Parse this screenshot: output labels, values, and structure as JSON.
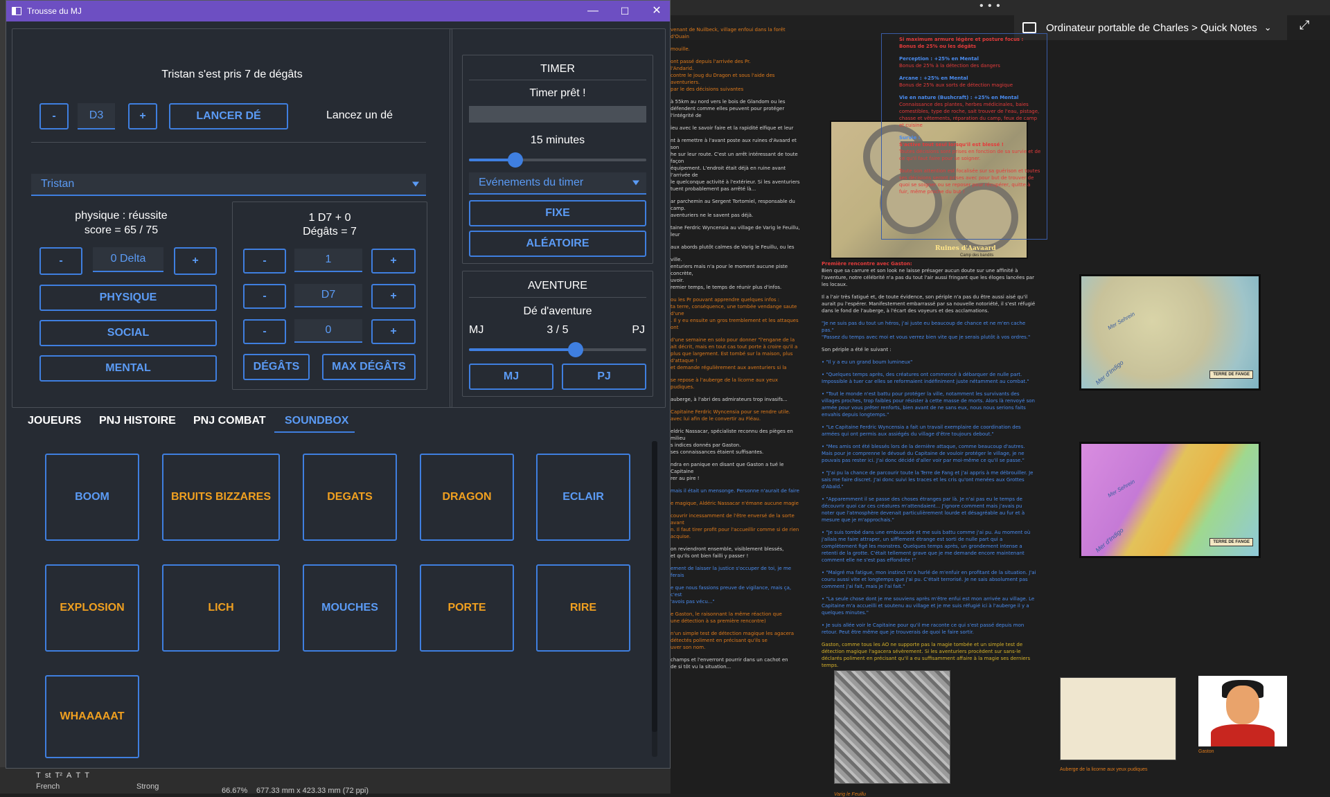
{
  "app": {
    "title": "Trousse du MJ",
    "window_controls": {
      "minimize": "—",
      "maximize": "☐",
      "close": "✕"
    },
    "top": {
      "message": "Tristan s'est pris 7 de dégâts",
      "dice_minus": "-",
      "dice_value": "D3",
      "dice_plus": "+",
      "roll_button": "LANCER DÉ",
      "roll_result": "Lancez un dé"
    },
    "player_select": {
      "selected": "Tristan"
    },
    "check": {
      "result": "physique : réussite",
      "score": "score = 65 / 75",
      "delta_minus": "-",
      "delta_value": "0 Delta",
      "delta_plus": "+",
      "btn_physique": "PHYSIQUE",
      "btn_social": "SOCIAL",
      "btn_mental": "MENTAL"
    },
    "damage": {
      "formula": "1 D7 + 0",
      "result": "Dégâts = 7",
      "rows": [
        {
          "minus": "-",
          "value": "1",
          "plus": "+"
        },
        {
          "minus": "-",
          "value": "D7",
          "plus": "+"
        },
        {
          "minus": "-",
          "value": "0",
          "plus": "+"
        }
      ],
      "btn_degats": "DÉGÂTS",
      "btn_max": "MAX DÉGÂTS"
    },
    "timer": {
      "title": "TIMER",
      "status": "Timer prêt !",
      "progress": 0,
      "duration_label": "15 minutes",
      "duration_slider": 0.26,
      "events_select": "Evénements du timer",
      "btn_fixe": "FIXE",
      "btn_aleatoire": "ALÉATOIRE"
    },
    "adventure": {
      "title": "AVENTURE",
      "subtitle": "Dé d'aventure",
      "left_label": "MJ",
      "value": "3 / 5",
      "right_label": "PJ",
      "slider": 0.6,
      "btn_mj": "MJ",
      "btn_pj": "PJ"
    },
    "tabs": [
      "JOUEURS",
      "PNJ HISTOIRE",
      "PNJ COMBAT",
      "SOUNDBOX"
    ],
    "active_tab": "SOUNDBOX",
    "sounds": [
      {
        "label": "BOOM",
        "color": "blue"
      },
      {
        "label": "BRUITS BIZZARES",
        "color": "orange"
      },
      {
        "label": "DEGATS",
        "color": "orange"
      },
      {
        "label": "DRAGON",
        "color": "orange"
      },
      {
        "label": "ECLAIR",
        "color": "blue"
      },
      {
        "label": "EXPLOSION",
        "color": "orange"
      },
      {
        "label": "LICH",
        "color": "orange"
      },
      {
        "label": "MOUCHES",
        "color": "blue"
      },
      {
        "label": "PORTE",
        "color": "orange"
      },
      {
        "label": "RIRE",
        "color": "orange"
      },
      {
        "label": "WHAAAAAT",
        "color": "orange"
      }
    ],
    "colors": {
      "accent": "#3f7fe0",
      "accent_text": "#5b9bf5",
      "orange_text": "#f0a020",
      "title_bar": "#6d4fc2",
      "background": "#262b33"
    }
  },
  "notes": {
    "breadcrumb": "Ordinateur portable de Charles > Quick Notes",
    "heading": "Première rencontre avec Gaston:",
    "intro": "Bien que sa carrure et son look ne laisse présager aucun doute sur une affinité à l'aventure, notre célébrité n'a pas du tout l'air aussi fringant que les éloges lancées par les locaux.",
    "para2": "Il a l'air très fatigué et, de toute évidence, son périple n'a pas du être aussi aisé qu'il aurait pu l'espérer. Manifestement embarrassé par sa nouvelle notoriété, il s'est réfugié dans le fond de l'auberge, à l'écart des voyeurs et des acclamations.",
    "quote1": "\"Je ne suis pas du tout un héros, j'ai juste eu beaucoup de chance et ne m'en cache pas.\"",
    "quote2": "\"Passez du temps avec moi et vous verrez bien vite que je serais plutôt à vos ordres.\"",
    "periple": "Son périple a été le suivant :",
    "caption_village": "Varig le Feuillu",
    "caption_inn": "Auberge de la licorne aux yeux pudiques",
    "caption_gaston": "Gaston",
    "map_castle_title": "Ruines d'Aavaard",
    "map_castle_sub": "Camp des bandits",
    "map_title": "TERRE DE FANGE",
    "map_sea": "Mer d'Indigo",
    "map_sea2": "Mer Sehrein",
    "rules_perception": "Perception : +25% en Mental",
    "rules_arcane": "Arcane : +25% en Mental",
    "rules_vie": "Vie en nature (Bushcraft) : +25% en Mental",
    "rules_survie": "Survie :",
    "rules_survie_text": "S'active tout seul lorsqu'il est blessé !",
    "rules_footer": "Toute son attention est focalisée sur sa guérison et toutes ses décisions seront prises avec pour but de trouver de quoi se soigner ou se reposer pour récupérer, quitte à fuir, même proche du but !",
    "rules_top": "Si maximum armure légère et posture focus : Bonus de 25% ou les dégâts"
  },
  "editor": {
    "zoom": "66.67%",
    "dimensions": "677.33 mm x 423.33 mm (72 ppi)",
    "language": "French",
    "strength": "Strong"
  }
}
